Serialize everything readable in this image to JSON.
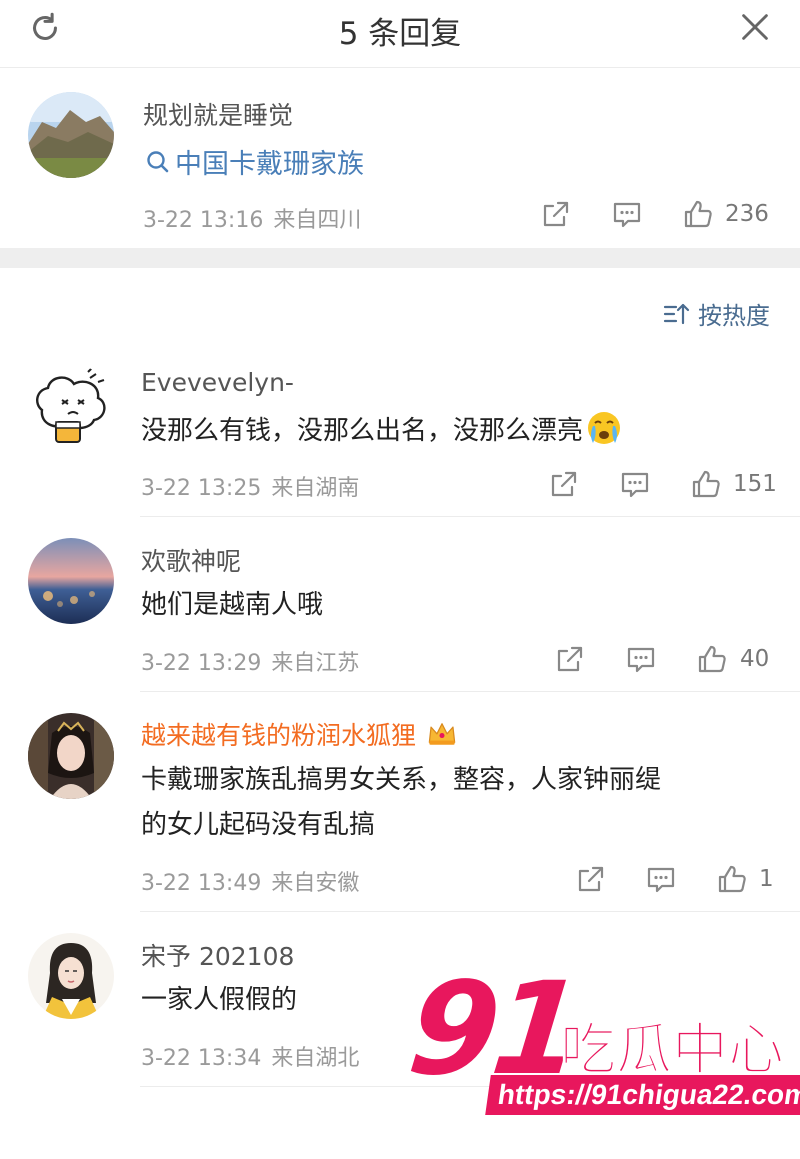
{
  "header": {
    "title": "5 条回复"
  },
  "root_comment": {
    "username": "规划就是睡觉",
    "topic": "中国卡戴珊家族",
    "date": "3-22 13:16",
    "location": "来自四川",
    "likes": "236"
  },
  "sort": {
    "label": "按热度"
  },
  "replies": [
    {
      "username": "Evevevelyn-",
      "content": "没那么有钱，没那么出名，没那么漂亮",
      "emoji": "crying-emoji",
      "date": "3-22 13:25",
      "location": "来自湖南",
      "likes": "151"
    },
    {
      "username": "欢歌神呢",
      "content": "她们是越南人哦",
      "date": "3-22 13:29",
      "location": "来自江苏",
      "likes": "40"
    },
    {
      "username": "越来越有钱的粉润水狐狸",
      "badge": "crown-icon",
      "content_line1": "卡戴珊家族乱搞男女关系，整容，人家钟丽缇",
      "content_line2": "的女儿起码没有乱搞",
      "date": "3-22 13:49",
      "location": "来自安徽",
      "likes": "1"
    },
    {
      "username": "宋予 202108",
      "content": "一家人假假的",
      "date": "3-22 13:34",
      "location": "来自湖北"
    }
  ],
  "watermark": {
    "number": "91",
    "brand": "吃瓜中心",
    "url": "https://91chigua22.com"
  },
  "colors": {
    "vip_name": "#f36c21",
    "topic_link": "#4a7fb8",
    "watermark": "#e8175d",
    "meta_text": "#9a9a9a"
  }
}
